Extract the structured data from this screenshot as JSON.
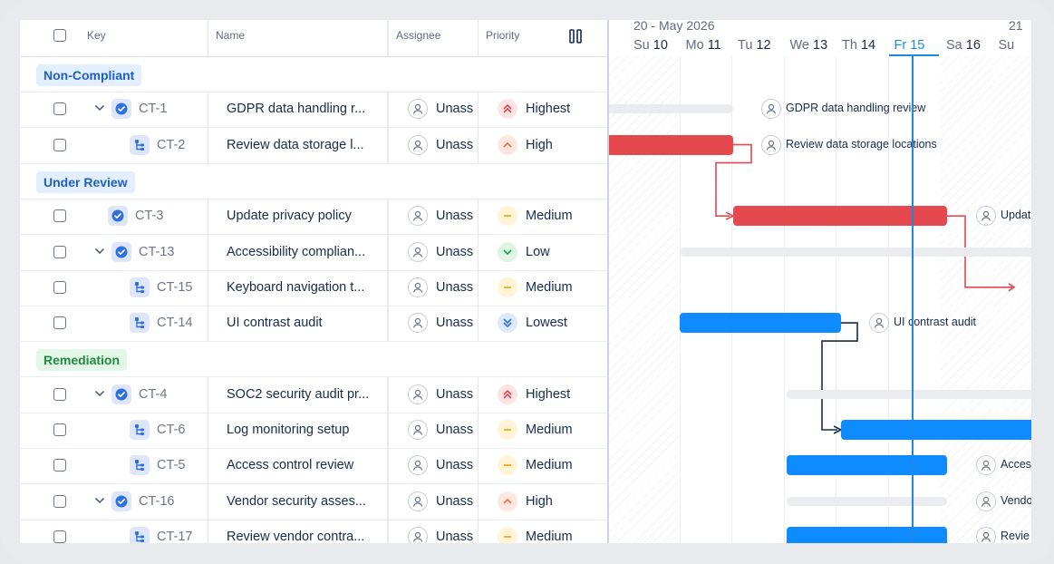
{
  "header": {
    "key": "Key",
    "name": "Name",
    "assignee": "Assignee",
    "priority": "Priority"
  },
  "timeline": {
    "month_label": "20 - May 2026",
    "next_label": "21",
    "days": [
      {
        "dow": "Su",
        "num": "10"
      },
      {
        "dow": "Mo",
        "num": "11"
      },
      {
        "dow": "Tu",
        "num": "12"
      },
      {
        "dow": "We",
        "num": "13"
      },
      {
        "dow": "Th",
        "num": "14"
      },
      {
        "dow": "Fr",
        "num": "15"
      },
      {
        "dow": "Sa",
        "num": "16"
      },
      {
        "dow": "Su",
        "num": ""
      }
    ],
    "today_index": 5
  },
  "groups": [
    {
      "label": "Non-Compliant",
      "bg": "#e3efff",
      "fg": "#1f5fbf"
    },
    {
      "label": "Under Review",
      "bg": "#e3efff",
      "fg": "#1f5fbf"
    },
    {
      "label": "Remediation",
      "bg": "#e3f7e8",
      "fg": "#1f8a3b"
    }
  ],
  "rows": [
    {
      "key": "CT-1",
      "name": "GDPR data handling r...",
      "assignee": "Unass",
      "priority": "Highest",
      "type": "task",
      "expand": true,
      "level": 0
    },
    {
      "key": "CT-2",
      "name": "Review data storage l...",
      "assignee": "Unass",
      "priority": "High",
      "type": "subtask",
      "expand": false,
      "level": 1
    },
    {
      "key": "CT-3",
      "name": "Update privacy policy",
      "assignee": "Unass",
      "priority": "Medium",
      "type": "task",
      "expand": false,
      "level": 0
    },
    {
      "key": "CT-13",
      "name": "Accessibility complian...",
      "assignee": "Unass",
      "priority": "Low",
      "type": "task",
      "expand": true,
      "level": 0
    },
    {
      "key": "CT-15",
      "name": "Keyboard navigation t...",
      "assignee": "Unass",
      "priority": "Medium",
      "type": "subtask",
      "expand": false,
      "level": 1
    },
    {
      "key": "CT-14",
      "name": "UI contrast audit",
      "assignee": "Unass",
      "priority": "Lowest",
      "type": "subtask",
      "expand": false,
      "level": 1
    },
    {
      "key": "CT-4",
      "name": "SOC2 security audit pr...",
      "assignee": "Unass",
      "priority": "Highest",
      "type": "task",
      "expand": true,
      "level": 0
    },
    {
      "key": "CT-6",
      "name": "Log monitoring setup",
      "assignee": "Unass",
      "priority": "Medium",
      "type": "subtask",
      "expand": false,
      "level": 1
    },
    {
      "key": "CT-5",
      "name": "Access control review",
      "assignee": "Unass",
      "priority": "Medium",
      "type": "subtask",
      "expand": false,
      "level": 1
    },
    {
      "key": "CT-16",
      "name": "Vendor security asses...",
      "assignee": "Unass",
      "priority": "High",
      "type": "task",
      "expand": true,
      "level": 0
    },
    {
      "key": "CT-17",
      "name": "Review vendor contra...",
      "assignee": "Unass",
      "priority": "Medium",
      "type": "subtask",
      "expand": false,
      "level": 1
    }
  ],
  "bar_labels": {
    "ct1": "GDPR data handling review",
    "ct2": "Review data storage locations",
    "ct3": "Updat",
    "ct14": "UI contrast audit",
    "ct5": "Acces",
    "ct16": "Vendo",
    "ct17": "Revie"
  },
  "colors": {
    "red_bar": "#e5484d",
    "blue_bar": "#0d8bff",
    "summary_bar": "#ebecf0",
    "today_line": "#1e88e5"
  }
}
